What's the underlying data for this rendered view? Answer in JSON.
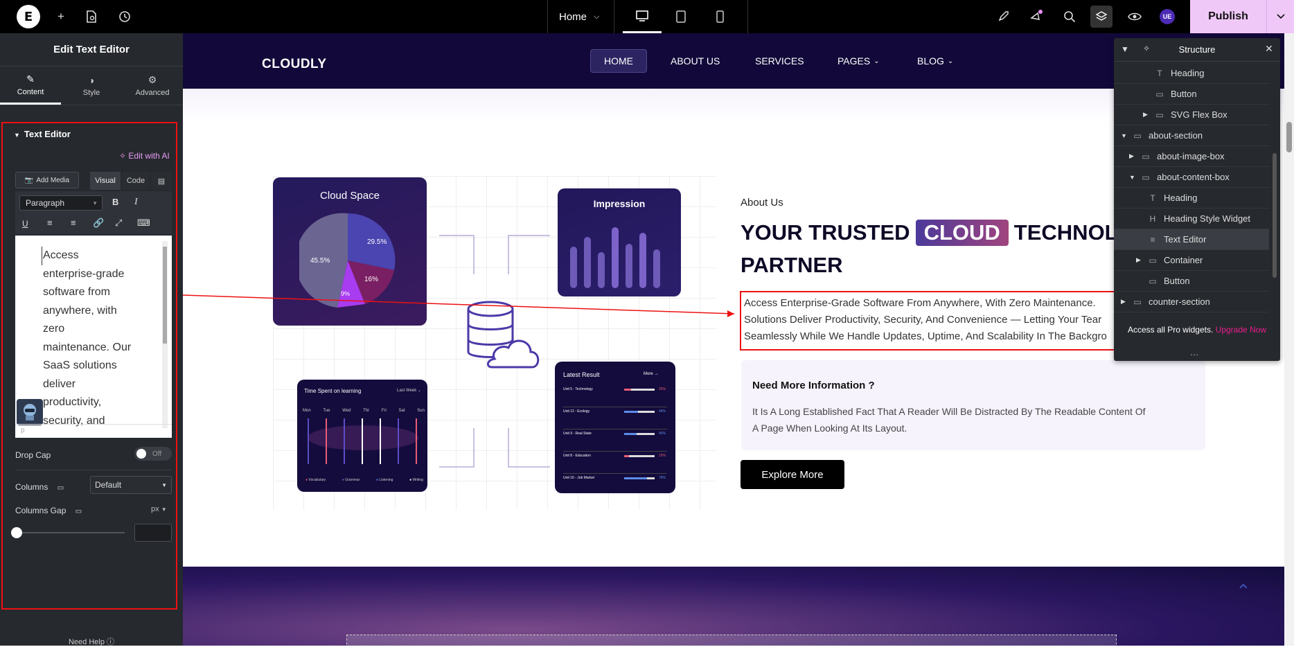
{
  "topbar": {
    "logo": "E",
    "page_name": "Home",
    "publish_label": "Publish",
    "user_badge": "UE"
  },
  "sidebar": {
    "title": "Edit Text Editor",
    "tabs": [
      {
        "label": "Content"
      },
      {
        "label": "Style"
      },
      {
        "label": "Advanced"
      }
    ],
    "section_title": "Text Editor",
    "edit_with_ai": "Edit with AI",
    "add_media": "Add Media",
    "visual_tab": "Visual",
    "code_tab": "Code",
    "format_select": "Paragraph",
    "editor_lines": [
      "Access",
      "enterprise-grade",
      "software from",
      "anywhere, with",
      "zero",
      "maintenance. Our",
      "SaaS solutions",
      "deliver",
      "productivity,",
      "security, and"
    ],
    "editor_footer": "p",
    "drop_cap_label": "Drop Cap",
    "drop_cap_value": "Off",
    "columns_label": "Columns",
    "columns_value": "Default",
    "columns_gap_label": "Columns Gap",
    "columns_gap_unit": "px",
    "help": "Need Help"
  },
  "site": {
    "brand": "CLOUDLY",
    "nav": [
      "HOME",
      "ABOUT US",
      "SERVICES",
      "PAGES",
      "BLOG"
    ],
    "about_label": "About Us",
    "heading_a": "YOUR TRUSTED",
    "heading_highlight": "CLOUD",
    "heading_b": "TECHNOL",
    "heading_c": "PARTNER",
    "para_lines": [
      "Access Enterprise-Grade Software From Anywhere, With Zero Maintenance.",
      "Solutions Deliver Productivity, Security, And Convenience — Letting Your Tear",
      "Seamlessly While We Handle Updates, Uptime, And Scalability In The Backgro"
    ],
    "info_title": "Need More Information ?",
    "info_lines": [
      "It Is A Long Established Fact That A Reader Will Be Distracted By The Readable Content Of",
      "A Page When Looking At Its Layout."
    ],
    "cta": "Explore More",
    "card_cloud_title": "Cloud Space",
    "pie_labels": [
      "45.5%",
      "29.5%",
      "16%",
      "9%"
    ],
    "card_impression_title": "Impression",
    "card_time_title": "Time Spent on learning",
    "card_time_filter": "Last Week",
    "days": [
      "Mon",
      "Tue",
      "Wed",
      "Thr",
      "Fri",
      "Sat",
      "Sun"
    ],
    "time_legend": [
      "Vocabulary",
      "Grammar",
      "Listening",
      "Writing"
    ],
    "card_result_title": "Latest Result",
    "card_result_more": "More",
    "results": [
      {
        "label": "Unit 5 - Technology",
        "pct": "25%"
      },
      {
        "label": "Unit 12 - Ecology",
        "pct": "44%"
      },
      {
        "label": "Unit 9 - Real State",
        "pct": "40%"
      },
      {
        "label": "Unit 8 - Education",
        "pct": "15%"
      },
      {
        "label": "Unit 16 - Job Market",
        "pct": "76%"
      }
    ]
  },
  "structure": {
    "title": "Structure",
    "items": [
      {
        "label": "Heading",
        "icon": "T"
      },
      {
        "label": "Button",
        "icon": "▭"
      },
      {
        "label": "SVG Flex Box",
        "icon": "▭"
      },
      {
        "label": "about-section",
        "icon": "▭"
      },
      {
        "label": "about-image-box",
        "icon": "▭"
      },
      {
        "label": "about-content-box",
        "icon": "▭"
      },
      {
        "label": "Heading",
        "icon": "T"
      },
      {
        "label": "Heading Style Widget",
        "icon": "H"
      },
      {
        "label": "Text Editor",
        "icon": "≡"
      },
      {
        "label": "Container",
        "icon": "▭"
      },
      {
        "label": "Button",
        "icon": "▭"
      },
      {
        "label": "counter-section",
        "icon": "▭"
      }
    ],
    "promo": "Access all Pro widgets.",
    "promo_link": "Upgrade Now"
  },
  "colors": {
    "accent": "#f0c8f8",
    "nav_bg": "#12093a",
    "selection": "#e11111",
    "upgrade": "#e91e8c"
  }
}
